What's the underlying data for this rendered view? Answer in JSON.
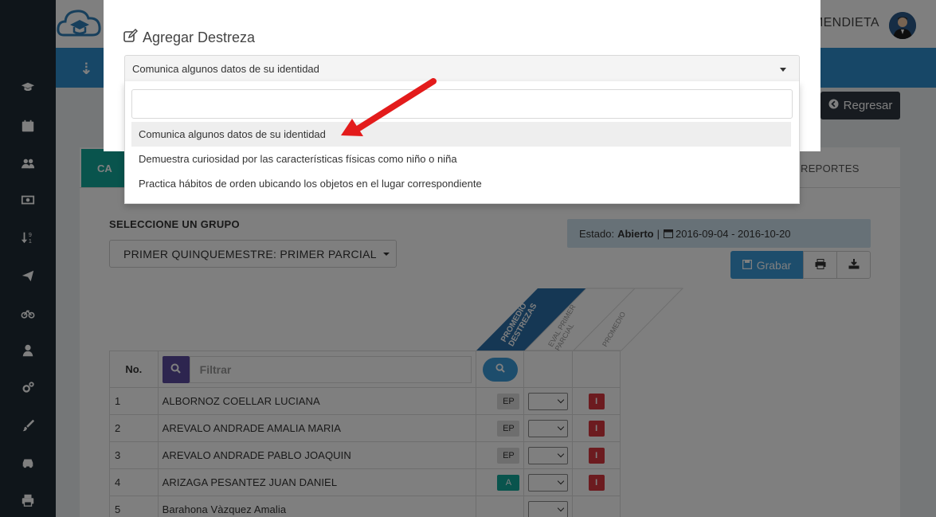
{
  "header": {
    "user_name": "MENDIETA"
  },
  "page": {
    "title_icon": "sort-numeric-icon",
    "back_label": "Regresar"
  },
  "tabs": {
    "active_label": "CA",
    "reportes_label": "REPORTES"
  },
  "group": {
    "label": "SELECCIONE UN GRUPO",
    "selected": "PRIMER QUINQUEMESTRE: PRIMER PARCIAL"
  },
  "estado": {
    "prefix": "Estado:",
    "value": "Abierto",
    "separator": "|",
    "dates": "2016-09-04 - 2016-10-20"
  },
  "actions": {
    "save_label": "Grabar"
  },
  "columns": {
    "promedio_destrezas_1": "PROMEDIO",
    "promedio_destrezas_2": "DESTREZAS",
    "eval_1": "EVAL PRIMER",
    "eval_2": "PARCIAL",
    "promedio": "PROMEDIO"
  },
  "table": {
    "no_header": "No.",
    "filter_placeholder": "Filtrar",
    "rows": [
      {
        "no": "1",
        "name": "ALBORNOZ COELLAR LUCIANA",
        "grade": "EP",
        "final": "I"
      },
      {
        "no": "2",
        "name": "AREVALO ANDRADE AMALIA MARIA",
        "grade": "EP",
        "final": "I"
      },
      {
        "no": "3",
        "name": "AREVALO ANDRADE PABLO JOAQUIN",
        "grade": "EP",
        "final": "I"
      },
      {
        "no": "4",
        "name": "ARIZAGA PESANTEZ JUAN DANIEL",
        "grade": "A",
        "final": "I"
      },
      {
        "no": "5",
        "name": "Barahona Vàzquez Amalia",
        "grade": "",
        "final": ""
      }
    ]
  },
  "modal": {
    "title": "Agregar Destreza",
    "selected_value": "Comunica algunos datos de su identidad",
    "search_value": "",
    "options": [
      "Comunica algunos datos de su identidad",
      "Demuestra curiosidad por las características físicas como niño o niña",
      "Practica hábitos de orden ubicando los objetos en el lugar correspondiente"
    ]
  },
  "colors": {
    "sidebar": "#1f2a35",
    "title_band": "#2f8ecf",
    "teal": "#12a89b",
    "primary": "#3a9ad9",
    "danger": "#d9373f",
    "filter_btn": "#5b4a9e",
    "annotation_arrow": "#e31b1b"
  }
}
